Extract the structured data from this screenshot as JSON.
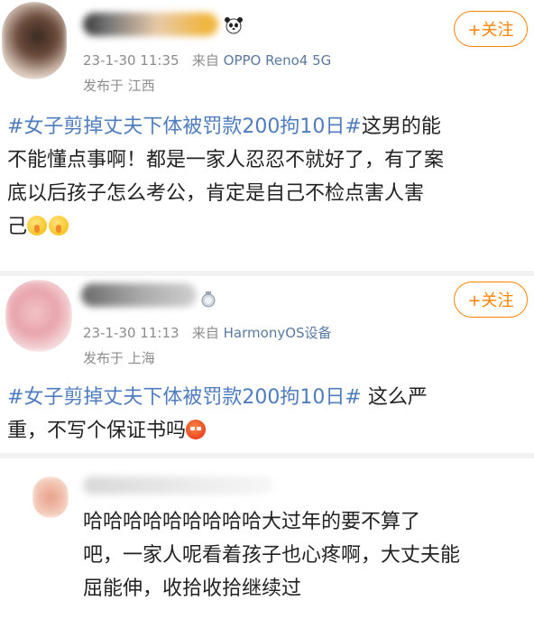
{
  "posts": [
    {
      "date": "23-1-30 11:35",
      "from_prefix": "来自",
      "device": "OPPO Reno4 5G",
      "location": "发布于 江西",
      "follow_label": "+关注",
      "topic": "#女子剪掉丈夫下体被罚款200拘10日#",
      "text_line1": "这男的能",
      "text_line2": "不能懂点事啊！都是一家人忍忍不就好了，有了案",
      "text_line3": "底以后孩子怎么考公，肯定是自己不检点害人害",
      "text_line4": "己"
    },
    {
      "date": "23-1-30 11:13",
      "from_prefix": "来自",
      "device": "HarmonyOS设备",
      "location": "发布于 上海",
      "follow_label": "+关注",
      "topic": "#女子剪掉丈夫下体被罚款200拘10日#",
      "text_line1": " 这么严",
      "text_line2": "重，不写个保证书吗"
    },
    {
      "text_line1": "哈哈哈哈哈哈哈哈哈大过年的要不算了",
      "text_line2": "吧，一家人呢看着孩子也心疼啊，大丈夫能",
      "text_line3": "屈能伸，收拾收拾继续过"
    }
  ],
  "icons": {
    "emoji_shush": "shushing-face-icon",
    "emoji_angry": "angry-face-icon",
    "panda": "panda-icon",
    "medal": "medal-icon"
  },
  "colors": {
    "topic": "#4f7cbf",
    "follow": "#ff8200",
    "meta": "#8c8c8c",
    "device": "#5a79a0"
  }
}
